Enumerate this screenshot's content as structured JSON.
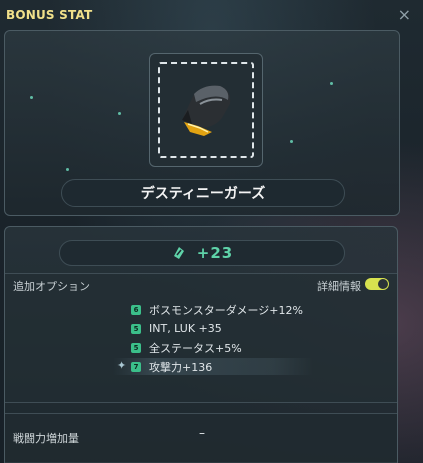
{
  "window": {
    "title": "BONUS STAT",
    "close_glyph": "×"
  },
  "item": {
    "name": "デスティニーガーズ",
    "icon": "black-gauntlet-icon"
  },
  "stat": {
    "icon": "bonus-stat-icon",
    "value": "+23"
  },
  "options": {
    "label": "追加オプション",
    "detail_label": "詳細情報",
    "detail_toggle_on": true,
    "rows": [
      {
        "grade": "6",
        "text": "ボスモンスターダメージ+12%"
      },
      {
        "grade": "5",
        "text": "INT, LUK  +35"
      },
      {
        "grade": "5",
        "text": "全ステータス+5%"
      },
      {
        "grade": "7",
        "text": "攻撃力+136"
      }
    ]
  },
  "power": {
    "label": "戦闘力増加量",
    "value": "–"
  },
  "colors": {
    "title": "#f0e08a",
    "stat_accent": "#5fd3a9",
    "toggle": "#d7e24f",
    "grade_badge": "#3bbf8a"
  }
}
